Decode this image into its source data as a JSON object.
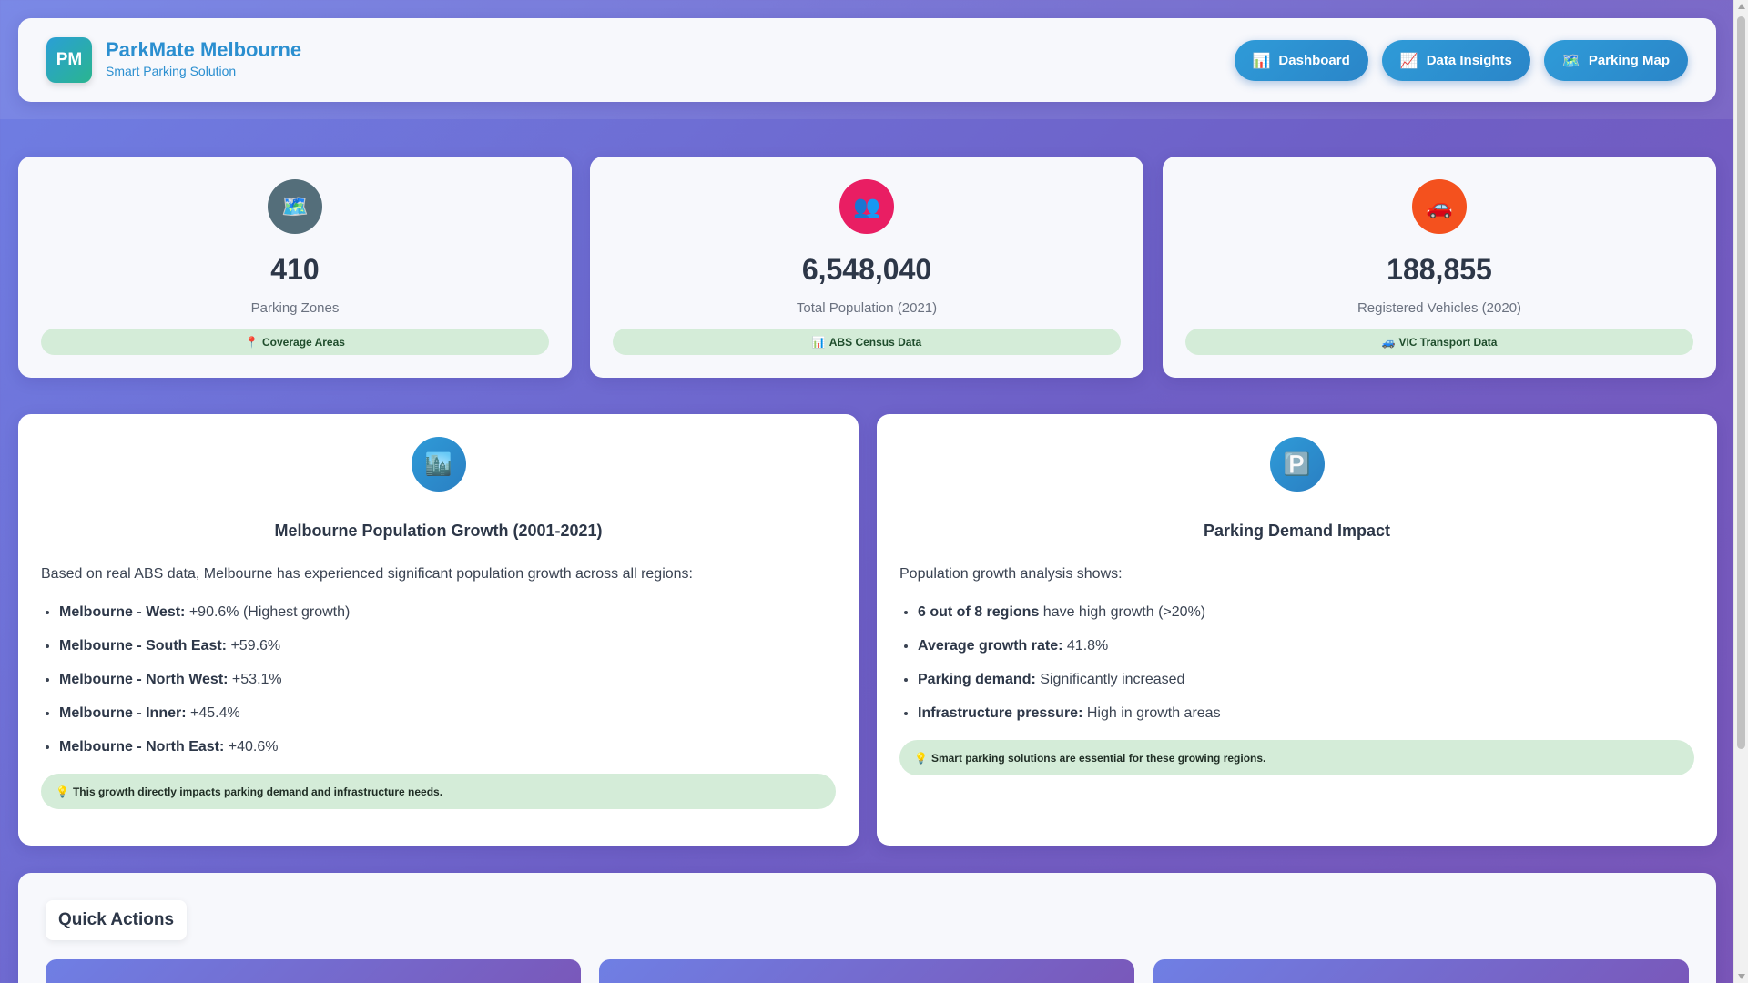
{
  "header": {
    "logo_text": "PM",
    "title": "ParkMate Melbourne",
    "subtitle": "Smart Parking Solution",
    "nav": [
      {
        "icon": "📊",
        "label": "Dashboard"
      },
      {
        "icon": "📈",
        "label": "Data Insights"
      },
      {
        "icon": "🗺️",
        "label": "Parking Map"
      }
    ]
  },
  "stats": [
    {
      "icon": "🗺️",
      "icon_bg": "#546e7a",
      "value": "410",
      "label": "Parking Zones",
      "badge_icon": "📍",
      "badge": "Coverage Areas"
    },
    {
      "icon": "👥",
      "icon_bg": "#e91e63",
      "value": "6,548,040",
      "label": "Total Population (2021)",
      "badge_icon": "📊",
      "badge": "ABS Census Data"
    },
    {
      "icon": "🚗",
      "icon_bg": "#f4511e",
      "value": "188,855",
      "label": "Registered Vehicles (2020)",
      "badge_icon": "🚙",
      "badge": "VIC Transport Data"
    }
  ],
  "population": {
    "icon": "🏙️",
    "title": "Melbourne Population Growth (2001-2021)",
    "intro": "Based on real ABS data, Melbourne has experienced significant population growth across all regions:",
    "items": [
      {
        "label": "Melbourne - West:",
        "text": " +90.6% (Highest growth)"
      },
      {
        "label": "Melbourne - South East:",
        "text": " +59.6%"
      },
      {
        "label": "Melbourne - North West:",
        "text": " +53.1%"
      },
      {
        "label": "Melbourne - Inner:",
        "text": " +45.4%"
      },
      {
        "label": "Melbourne - North East:",
        "text": " +40.6%"
      }
    ],
    "note_icon": "💡",
    "note": "This growth directly impacts parking demand and infrastructure needs."
  },
  "demand": {
    "icon": "🅿️",
    "title": "Parking Demand Impact",
    "intro": "Population growth analysis shows:",
    "items": [
      {
        "label": "6 out of 8 regions",
        "text": " have high growth (>20%)"
      },
      {
        "label": "Average growth rate:",
        "text": " 41.8%"
      },
      {
        "label": "Parking demand:",
        "text": " Significantly increased"
      },
      {
        "label": "Infrastructure pressure:",
        "text": " High in growth areas"
      }
    ],
    "note_icon": "💡",
    "note": "Smart parking solutions are essential for these growing regions."
  },
  "quick_actions": {
    "title": "Quick Actions"
  }
}
